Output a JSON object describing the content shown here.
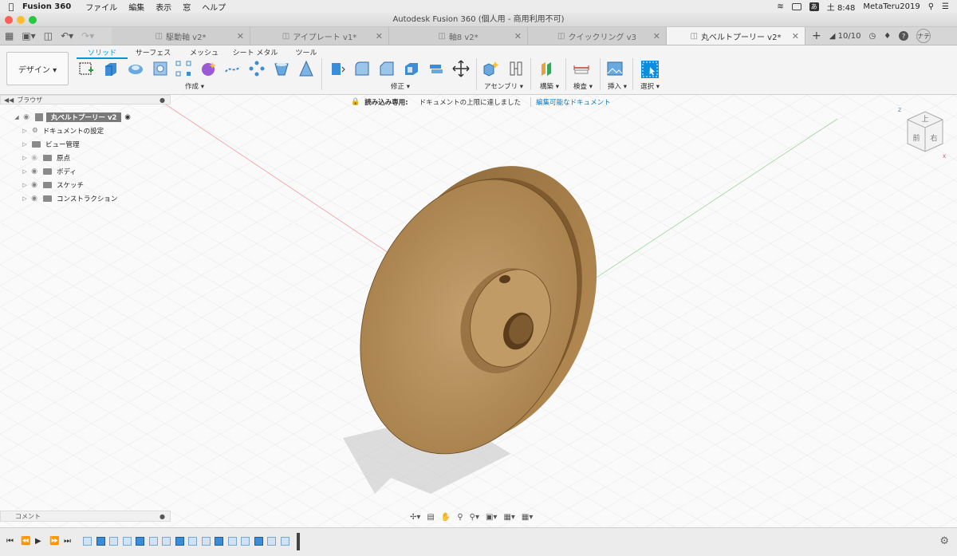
{
  "menubar": {
    "app_name": "Fusion 360",
    "items": [
      "ファイル",
      "編集",
      "表示",
      "窓",
      "ヘルプ"
    ],
    "clock": "土 8:48",
    "user": "MetaTeru2019",
    "input_lang": "あ"
  },
  "window": {
    "title": "Autodesk Fusion 360 (個人用 - 商用利用不可)"
  },
  "tabs": [
    {
      "label": "駆動軸 v2*"
    },
    {
      "label": "アイプレート v1*"
    },
    {
      "label": "軸8 v2*"
    },
    {
      "label": "クイックリング v3"
    },
    {
      "label": "丸ベルトプーリー v2*"
    }
  ],
  "jobs": {
    "count": "10/10"
  },
  "account_initials": "ナテ",
  "workspace": {
    "label": "デザイン ▾"
  },
  "categories": [
    "ソリッド",
    "サーフェス",
    "メッシュ",
    "シート メタル",
    "ツール"
  ],
  "tool_groups": {
    "create": "作成 ▾",
    "modify": "修正 ▾",
    "assemble": "アセンブリ ▾",
    "construct": "構築 ▾",
    "inspect": "検査 ▾",
    "insert": "挿入 ▾",
    "select": "選択 ▾"
  },
  "browser": {
    "title": "ブラウザ",
    "root": "丸ベルトプーリー v2",
    "items": [
      "ドキュメントの設定",
      "ビュー管理",
      "原点",
      "ボディ",
      "スケッチ",
      "コンストラクション"
    ]
  },
  "banner": {
    "prefix": "読み込み専用:",
    "message": "ドキュメントの上限に達しました",
    "link": "編集可能なドキュメント"
  },
  "comments": {
    "title": "コメント"
  },
  "navcube": {
    "top": "上",
    "front": "前",
    "right": "右",
    "z": "Z",
    "x": "X"
  },
  "colors": {
    "accent": "#0696d7",
    "lock": "#e03a3a",
    "wood": "#b0874f"
  }
}
